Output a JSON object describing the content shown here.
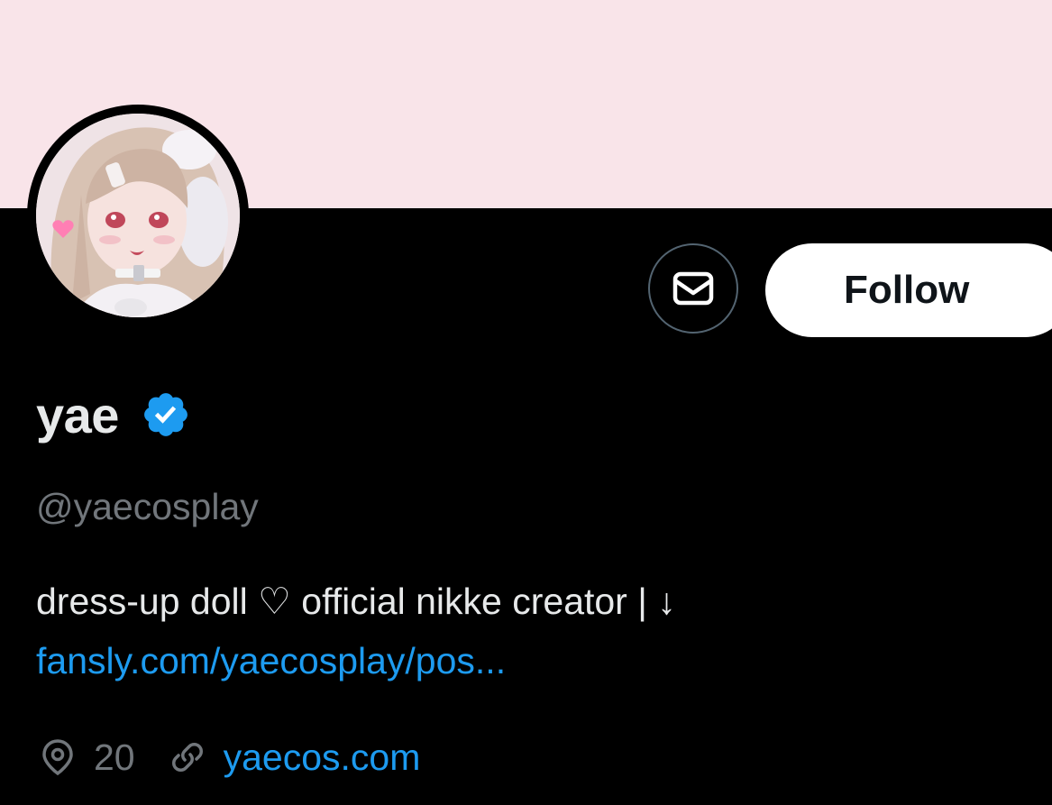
{
  "profile": {
    "display_name": "yae",
    "handle": "@yaecosplay",
    "bio_text": "dress-up doll ♡ official nikke creator | ↓",
    "bio_link": "fansly.com/yaecosplay/pos...",
    "location": "20",
    "website": "yaecos.com"
  },
  "actions": {
    "follow_label": "Follow"
  },
  "icons": {
    "message": "envelope-icon",
    "verified": "verified-badge-icon",
    "location": "location-pin-icon",
    "link": "link-icon"
  },
  "colors": {
    "banner": "#f9e4e9",
    "background": "#000000",
    "accent": "#1d9bf0",
    "primary_text": "#e7e9ea",
    "secondary_text": "#71767b",
    "button_bg": "#ffffff"
  }
}
